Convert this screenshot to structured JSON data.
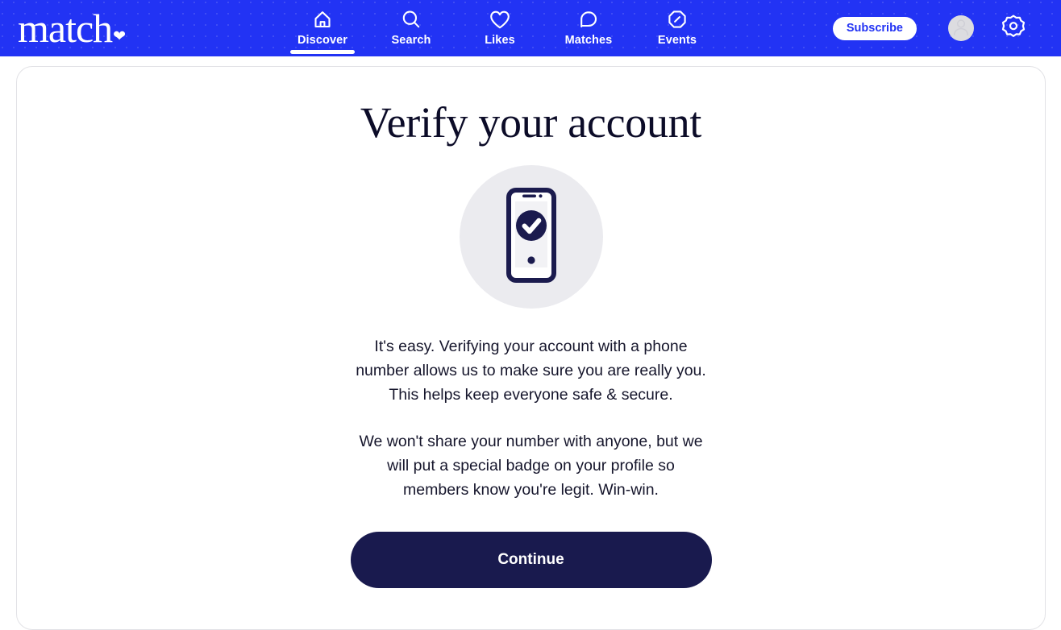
{
  "brand": {
    "name": "match",
    "heart_icon": "heart-icon",
    "primary_blue": "#2233f4",
    "navy": "#191a4e"
  },
  "header": {
    "nav": [
      {
        "label": "Discover",
        "icon": "home-icon",
        "active": true
      },
      {
        "label": "Search",
        "icon": "search-icon",
        "active": false
      },
      {
        "label": "Likes",
        "icon": "heart-outline-icon",
        "active": false
      },
      {
        "label": "Matches",
        "icon": "chat-bubble-icon",
        "active": false
      },
      {
        "label": "Events",
        "icon": "ticket-icon",
        "active": false
      }
    ],
    "subscribe_label": "Subscribe",
    "avatar_icon": "user-avatar-icon",
    "settings_icon": "gear-icon"
  },
  "main": {
    "title": "Verify your account",
    "illustration_icon": "phone-verified-icon",
    "paragraph_1": "It's easy. Verifying your account with a phone number allows us to make sure you are really you. This helps keep everyone safe & secure.",
    "paragraph_2": "We won't share your number with anyone, but we will put a special badge on your profile so members know you're legit. Win-win.",
    "continue_label": "Continue"
  }
}
